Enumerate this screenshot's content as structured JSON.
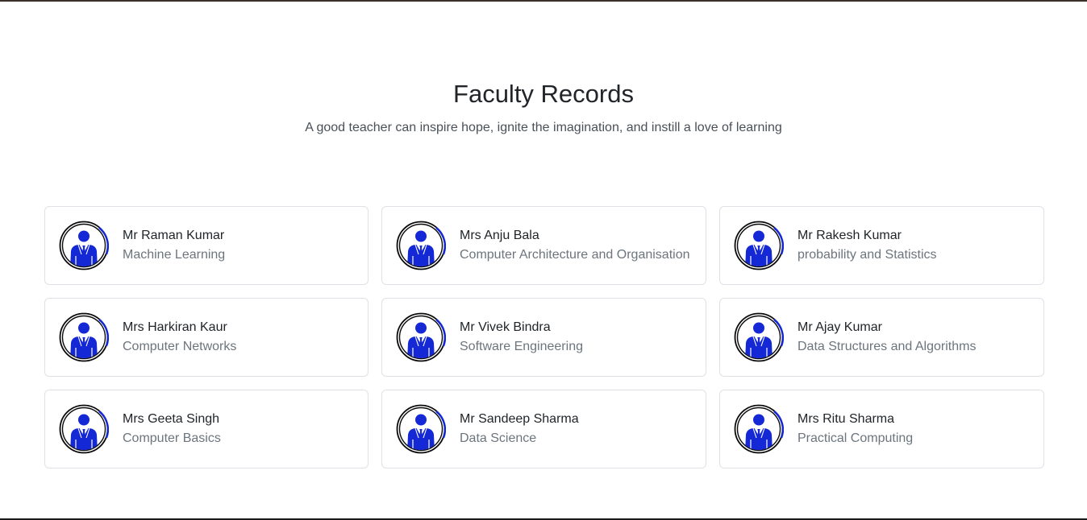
{
  "header": {
    "title": "Faculty Records",
    "subtitle": "A good teacher can inspire hope, ignite the imagination, and instill a love of learning"
  },
  "colors": {
    "avatar_blue": "#1428d6",
    "avatar_ring": "#0b0b0b"
  },
  "faculty": [
    {
      "name": "Mr Raman Kumar",
      "subject": "Machine Learning",
      "icon": "teacher-avatar-icon"
    },
    {
      "name": "Mrs Anju Bala",
      "subject": "Computer Architecture and Organisation",
      "icon": "teacher-avatar-icon"
    },
    {
      "name": "Mr Rakesh Kumar",
      "subject": "probability and Statistics",
      "icon": "teacher-avatar-icon"
    },
    {
      "name": "Mrs Harkiran Kaur",
      "subject": "Computer Networks",
      "icon": "teacher-avatar-icon"
    },
    {
      "name": "Mr Vivek Bindra",
      "subject": "Software Engineering",
      "icon": "teacher-avatar-icon"
    },
    {
      "name": "Mr Ajay Kumar",
      "subject": "Data Structures and Algorithms",
      "icon": "teacher-avatar-icon"
    },
    {
      "name": "Mrs Geeta Singh",
      "subject": "Computer Basics",
      "icon": "teacher-avatar-icon"
    },
    {
      "name": "Mr Sandeep Sharma",
      "subject": "Data Science",
      "icon": "teacher-avatar-icon"
    },
    {
      "name": "Mrs Ritu Sharma",
      "subject": "Practical Computing",
      "icon": "teacher-avatar-icon"
    }
  ]
}
